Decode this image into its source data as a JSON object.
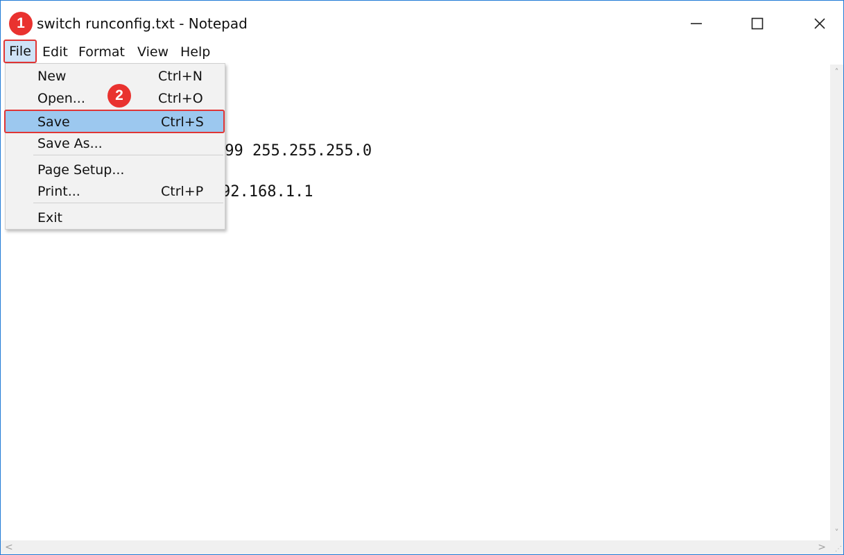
{
  "window": {
    "title": "switch runconfig.txt - Notepad",
    "minimize_glyph": "—",
    "maximize_glyph": "☐",
    "close_glyph": "✕"
  },
  "callouts": {
    "step1": "1",
    "step2": "2",
    "color": "#e9322f"
  },
  "menubar": {
    "file": "File",
    "edit": "Edit",
    "format": "Format",
    "view": "View",
    "help": "Help"
  },
  "file_menu": {
    "items": [
      {
        "label": "New",
        "shortcut": "Ctrl+N"
      },
      {
        "label": "Open...",
        "shortcut": "Ctrl+O"
      },
      {
        "label": "Save",
        "shortcut": "Ctrl+S"
      },
      {
        "label": "Save As...",
        "shortcut": ""
      },
      {
        "label": "Page Setup...",
        "shortcut": ""
      },
      {
        "label": "Print...",
        "shortcut": "Ctrl+P"
      },
      {
        "label": "Exit",
        "shortcut": ""
      }
    ],
    "highlight_color": "#9cc8ef"
  },
  "editor": {
    "line1_visible": ".99 255.255.255.0",
    "line2_visible": "92.168.1.1"
  },
  "scrollbars": {
    "up": "˄",
    "down": "˅",
    "left": "<",
    "right": ">"
  },
  "colors": {
    "accent_border": "#1f7ad6",
    "annotation_red": "#e03535"
  }
}
